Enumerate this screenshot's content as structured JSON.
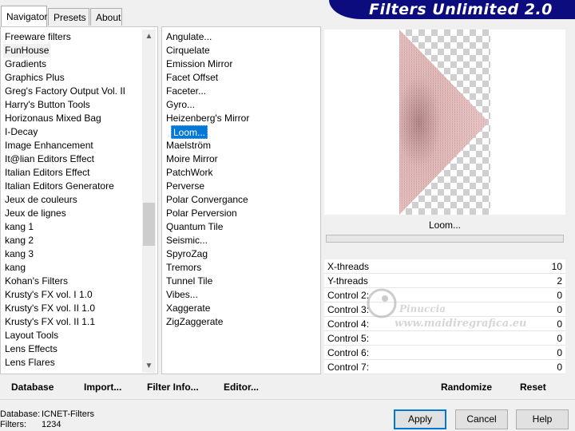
{
  "tabs": [
    {
      "label": "Navigator",
      "active": true
    },
    {
      "label": "Presets",
      "active": false
    },
    {
      "label": "About",
      "active": false
    }
  ],
  "title": "Filters Unlimited 2.0",
  "categories": [
    "Freeware filters",
    "FunHouse",
    "Gradients",
    "Graphics Plus",
    "Greg's Factory Output Vol. II",
    "Harry's Button Tools",
    "Horizonaus Mixed Bag",
    "I-Decay",
    "Image Enhancement",
    "It@lian Editors Effect",
    "Italian Editors Effect",
    "Italian Editors Generatore",
    "Jeux de couleurs",
    "Jeux de lignes",
    "kang 1",
    "kang 2",
    "kang 3",
    "kang",
    "Kohan's Filters",
    "Krusty's FX vol. I 1.0",
    "Krusty's FX vol. II 1.0",
    "Krusty's FX vol. II 1.1",
    "Layout Tools",
    "Lens Effects",
    "Lens Flares"
  ],
  "selected_category": 1,
  "filters": [
    "Angulate...",
    "Cirquelate",
    "Emission Mirror",
    "Facet Offset",
    "Faceter...",
    "Gyro...",
    "Heizenberg's Mirror",
    "Loom...",
    "Maelström",
    "Moire Mirror",
    "PatchWork",
    "Perverse",
    "Polar Convergance",
    "Polar Perversion",
    "Quantum Tile",
    "Seismic...",
    "SpyroZag",
    "Tremors",
    "Tunnel Tile",
    "Vibes...",
    "Xaggerate",
    "ZigZaggerate"
  ],
  "selected_filter": 7,
  "current_filter": "Loom...",
  "controls": [
    {
      "label": "X-threads",
      "value": "10"
    },
    {
      "label": "Y-threads",
      "value": "2"
    },
    {
      "label": "Control 2:",
      "value": "0"
    },
    {
      "label": "Control 3:",
      "value": "0"
    },
    {
      "label": "Control 4:",
      "value": "0"
    },
    {
      "label": "Control 5:",
      "value": "0"
    },
    {
      "label": "Control 6:",
      "value": "0"
    },
    {
      "label": "Control 7:",
      "value": "0"
    }
  ],
  "toolbar": {
    "database": "Database",
    "import": "Import...",
    "filter_info": "Filter Info...",
    "editor": "Editor...",
    "randomize": "Randomize",
    "reset": "Reset"
  },
  "dialog": {
    "apply": "Apply",
    "cancel": "Cancel",
    "help": "Help"
  },
  "status": {
    "database_label": "Database:",
    "database_value": "ICNET-Filters",
    "filters_label": "Filters:",
    "filters_value": "1234"
  },
  "watermark": {
    "name": "Pinuccia",
    "site": "www.maidiregrafica.eu"
  },
  "colors": {
    "banner": "#0c0c7e",
    "selection": "#0078d7",
    "preview_pink": "#e8c4c4",
    "preview_dark": "#8a5a5a"
  }
}
